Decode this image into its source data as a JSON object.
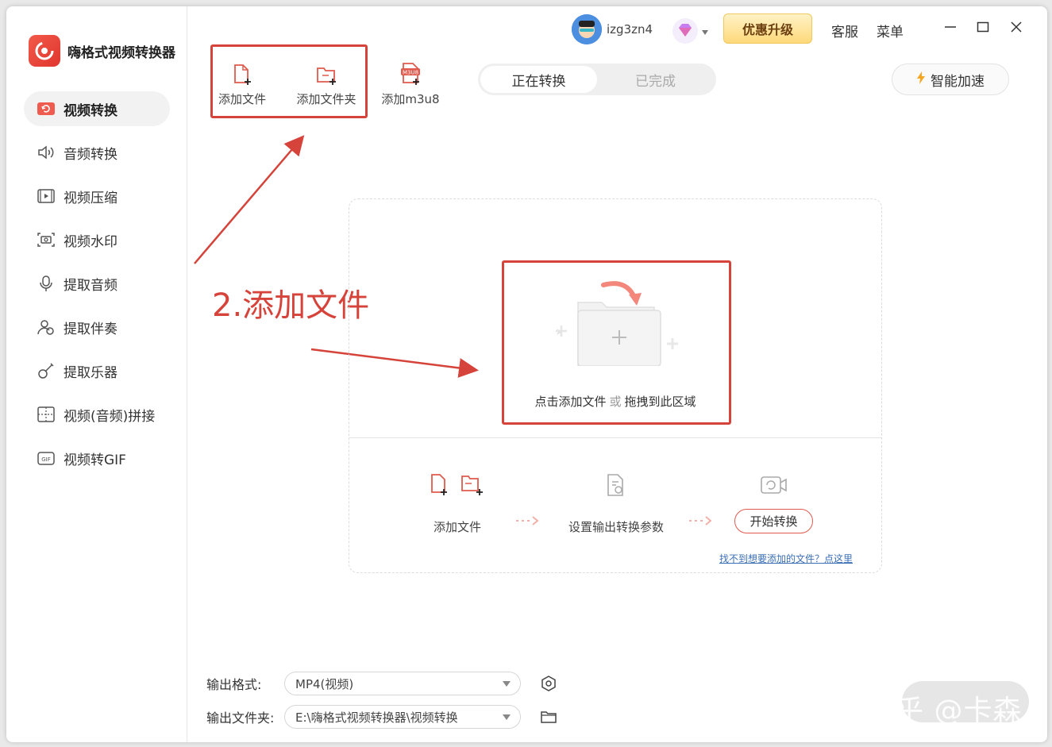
{
  "app": {
    "name": "嗨格式视频转换器"
  },
  "sidebar": {
    "items": [
      {
        "label": "视频转换",
        "active": true
      },
      {
        "label": "音频转换"
      },
      {
        "label": "视频压缩"
      },
      {
        "label": "视频水印"
      },
      {
        "label": "提取音频"
      },
      {
        "label": "提取伴奏"
      },
      {
        "label": "提取乐器"
      },
      {
        "label": "视频(音频)拼接"
      },
      {
        "label": "视频转GIF"
      }
    ]
  },
  "header": {
    "username": "izg3zn4",
    "upgrade_label": "优惠升级",
    "service_label": "客服",
    "menu_label": "菜单"
  },
  "toolbar": {
    "add_file": "添加文件",
    "add_folder": "添加文件夹",
    "add_m3u8": "添加m3u8",
    "m3u8_badge": "M3U8"
  },
  "tabs": {
    "converting": "正在转换",
    "done": "已完成"
  },
  "accelerate_label": "智能加速",
  "annotation": "2.添加文件",
  "dropzone": {
    "click_add": "点击添加文件",
    "or": "或",
    "drag_here": "拖拽到此区域",
    "steps": {
      "add": "添加文件",
      "params": "设置输出转换参数",
      "start": "开始转换"
    },
    "help_link": "找不到想要添加的文件？点这里"
  },
  "settings": {
    "format_label": "输出格式:",
    "format_value": "MP4(视频)",
    "folder_label": "输出文件夹:",
    "folder_value": "E:\\嗨格式视频转换器\\视频转换"
  },
  "watermark": "知乎 @卡森",
  "colors": {
    "accent": "#d5433a",
    "upgrade_bg": "#ffd97a",
    "link": "#3b6fb6"
  }
}
